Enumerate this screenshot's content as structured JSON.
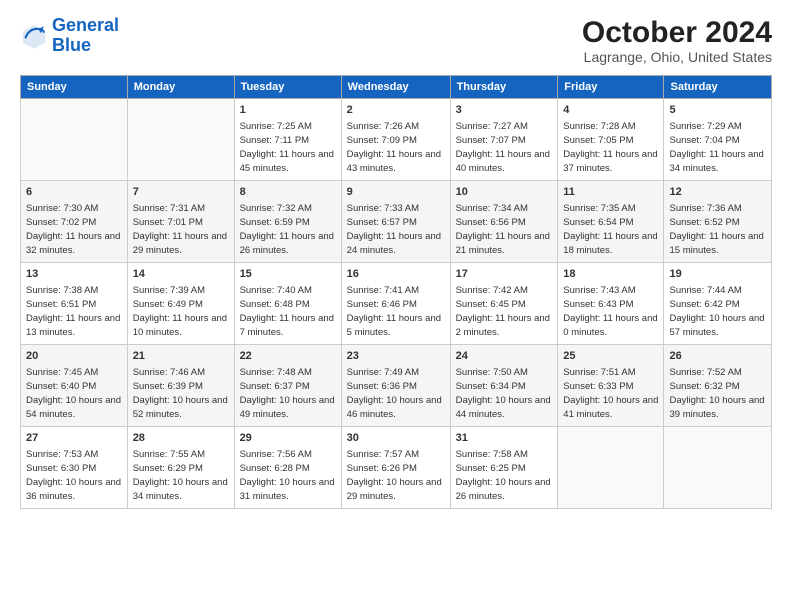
{
  "header": {
    "logo_general": "General",
    "logo_blue": "Blue",
    "month": "October 2024",
    "location": "Lagrange, Ohio, United States"
  },
  "days_of_week": [
    "Sunday",
    "Monday",
    "Tuesday",
    "Wednesday",
    "Thursday",
    "Friday",
    "Saturday"
  ],
  "weeks": [
    [
      {
        "day": "",
        "info": ""
      },
      {
        "day": "",
        "info": ""
      },
      {
        "day": "1",
        "info": "Sunrise: 7:25 AM\nSunset: 7:11 PM\nDaylight: 11 hours and 45 minutes."
      },
      {
        "day": "2",
        "info": "Sunrise: 7:26 AM\nSunset: 7:09 PM\nDaylight: 11 hours and 43 minutes."
      },
      {
        "day": "3",
        "info": "Sunrise: 7:27 AM\nSunset: 7:07 PM\nDaylight: 11 hours and 40 minutes."
      },
      {
        "day": "4",
        "info": "Sunrise: 7:28 AM\nSunset: 7:05 PM\nDaylight: 11 hours and 37 minutes."
      },
      {
        "day": "5",
        "info": "Sunrise: 7:29 AM\nSunset: 7:04 PM\nDaylight: 11 hours and 34 minutes."
      }
    ],
    [
      {
        "day": "6",
        "info": "Sunrise: 7:30 AM\nSunset: 7:02 PM\nDaylight: 11 hours and 32 minutes."
      },
      {
        "day": "7",
        "info": "Sunrise: 7:31 AM\nSunset: 7:01 PM\nDaylight: 11 hours and 29 minutes."
      },
      {
        "day": "8",
        "info": "Sunrise: 7:32 AM\nSunset: 6:59 PM\nDaylight: 11 hours and 26 minutes."
      },
      {
        "day": "9",
        "info": "Sunrise: 7:33 AM\nSunset: 6:57 PM\nDaylight: 11 hours and 24 minutes."
      },
      {
        "day": "10",
        "info": "Sunrise: 7:34 AM\nSunset: 6:56 PM\nDaylight: 11 hours and 21 minutes."
      },
      {
        "day": "11",
        "info": "Sunrise: 7:35 AM\nSunset: 6:54 PM\nDaylight: 11 hours and 18 minutes."
      },
      {
        "day": "12",
        "info": "Sunrise: 7:36 AM\nSunset: 6:52 PM\nDaylight: 11 hours and 15 minutes."
      }
    ],
    [
      {
        "day": "13",
        "info": "Sunrise: 7:38 AM\nSunset: 6:51 PM\nDaylight: 11 hours and 13 minutes."
      },
      {
        "day": "14",
        "info": "Sunrise: 7:39 AM\nSunset: 6:49 PM\nDaylight: 11 hours and 10 minutes."
      },
      {
        "day": "15",
        "info": "Sunrise: 7:40 AM\nSunset: 6:48 PM\nDaylight: 11 hours and 7 minutes."
      },
      {
        "day": "16",
        "info": "Sunrise: 7:41 AM\nSunset: 6:46 PM\nDaylight: 11 hours and 5 minutes."
      },
      {
        "day": "17",
        "info": "Sunrise: 7:42 AM\nSunset: 6:45 PM\nDaylight: 11 hours and 2 minutes."
      },
      {
        "day": "18",
        "info": "Sunrise: 7:43 AM\nSunset: 6:43 PM\nDaylight: 11 hours and 0 minutes."
      },
      {
        "day": "19",
        "info": "Sunrise: 7:44 AM\nSunset: 6:42 PM\nDaylight: 10 hours and 57 minutes."
      }
    ],
    [
      {
        "day": "20",
        "info": "Sunrise: 7:45 AM\nSunset: 6:40 PM\nDaylight: 10 hours and 54 minutes."
      },
      {
        "day": "21",
        "info": "Sunrise: 7:46 AM\nSunset: 6:39 PM\nDaylight: 10 hours and 52 minutes."
      },
      {
        "day": "22",
        "info": "Sunrise: 7:48 AM\nSunset: 6:37 PM\nDaylight: 10 hours and 49 minutes."
      },
      {
        "day": "23",
        "info": "Sunrise: 7:49 AM\nSunset: 6:36 PM\nDaylight: 10 hours and 46 minutes."
      },
      {
        "day": "24",
        "info": "Sunrise: 7:50 AM\nSunset: 6:34 PM\nDaylight: 10 hours and 44 minutes."
      },
      {
        "day": "25",
        "info": "Sunrise: 7:51 AM\nSunset: 6:33 PM\nDaylight: 10 hours and 41 minutes."
      },
      {
        "day": "26",
        "info": "Sunrise: 7:52 AM\nSunset: 6:32 PM\nDaylight: 10 hours and 39 minutes."
      }
    ],
    [
      {
        "day": "27",
        "info": "Sunrise: 7:53 AM\nSunset: 6:30 PM\nDaylight: 10 hours and 36 minutes."
      },
      {
        "day": "28",
        "info": "Sunrise: 7:55 AM\nSunset: 6:29 PM\nDaylight: 10 hours and 34 minutes."
      },
      {
        "day": "29",
        "info": "Sunrise: 7:56 AM\nSunset: 6:28 PM\nDaylight: 10 hours and 31 minutes."
      },
      {
        "day": "30",
        "info": "Sunrise: 7:57 AM\nSunset: 6:26 PM\nDaylight: 10 hours and 29 minutes."
      },
      {
        "day": "31",
        "info": "Sunrise: 7:58 AM\nSunset: 6:25 PM\nDaylight: 10 hours and 26 minutes."
      },
      {
        "day": "",
        "info": ""
      },
      {
        "day": "",
        "info": ""
      }
    ]
  ]
}
